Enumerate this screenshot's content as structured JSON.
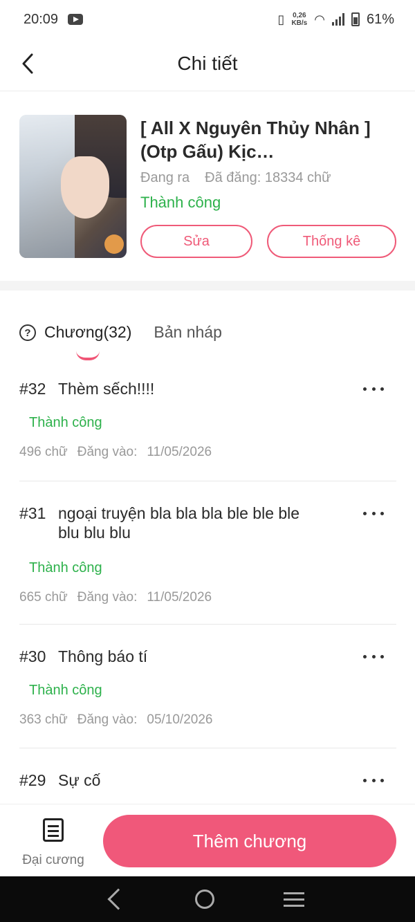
{
  "status_bar": {
    "time": "20:09",
    "speed_top": "0,26",
    "speed_bottom": "KB/s",
    "battery": "61%"
  },
  "header": {
    "title": "Chi tiết"
  },
  "book": {
    "title": "[ All X Nguyên Thủy Nhân ] (Otp Gấu) Kịc…",
    "state": "Đang ra",
    "word_count": "Đã đăng: 18334 chữ",
    "status": "Thành công",
    "edit_label": "Sửa",
    "stats_label": "Thống kê"
  },
  "tabs": {
    "help_icon": "?",
    "chapters_label": "Chương(32)",
    "drafts_label": "Bản nháp"
  },
  "chapters": [
    {
      "num": "#32",
      "title": "Thèm sếch!!!!",
      "status": "Thành công",
      "words": "496 chữ",
      "posted_label": "Đăng vào:",
      "date": "11/05/2026"
    },
    {
      "num": "#31",
      "title": "ngoại truyện bla bla bla ble ble ble blu blu blu",
      "status": "Thành công",
      "words": "665 chữ",
      "posted_label": "Đăng vào:",
      "date": "11/05/2026"
    },
    {
      "num": "#30",
      "title": "Thông báo tí",
      "status": "Thành công",
      "words": "363 chữ",
      "posted_label": "Đăng vào:",
      "date": "05/10/2026"
    },
    {
      "num": "#29",
      "title": "Sự cố"
    }
  ],
  "bottom": {
    "outline_label": "Đại cương",
    "add_chapter_label": "Thêm chương"
  },
  "colors": {
    "accent": "#f0587a",
    "success": "#2db14b"
  }
}
